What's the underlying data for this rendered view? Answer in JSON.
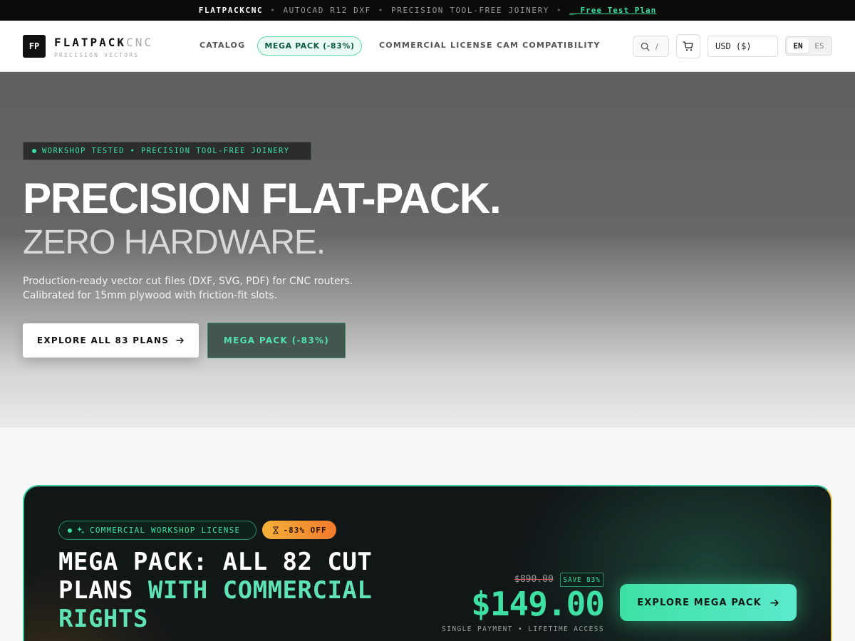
{
  "topbar": {
    "brand": "FLATPACKCNC",
    "sep1": "•",
    "format": "AUTOCAD R12 DXF",
    "sep2": "•",
    "tagline": "PRECISION TOOL-FREE JOINERY",
    "sep3": "•",
    "link": "_ Free Test Plan"
  },
  "header": {
    "logo_mark": "FP",
    "logo_name_main": "FLATPACK",
    "logo_name_suffix": "CNC",
    "logo_sub": "PRECISION VECTORS",
    "nav": {
      "catalog": "CATALOG",
      "mega_pack": "MEGA PACK (-83%)",
      "commercial": "COMMERCIAL LICENSE",
      "cam": "CAM COMPATIBILITY"
    },
    "search_shortcut": "/",
    "currency": "USD ($)",
    "lang_en": "EN",
    "lang_es": "ES"
  },
  "hero": {
    "badge": "WORKSHOP TESTED • PRECISION TOOL-FREE JOINERY",
    "title": "PRECISION FLAT-PACK.",
    "subtitle": "ZERO HARDWARE.",
    "description": "Production-ready vector cut files (DXF, SVG, PDF) for CNC routers. Calibrated for 15mm plywood with friction-fit slots.",
    "cta_primary": "EXPLORE ALL 83 PLANS",
    "cta_secondary": "MEGA PACK (-83%)"
  },
  "mega_card": {
    "badge": "COMMERCIAL WORKSHOP LICENSE",
    "off_badge": "-83% OFF",
    "title_main": "MEGA PACK: ALL 82 CUT PLANS ",
    "title_accent": "WITH COMMERCIAL RIGHTS",
    "price_old": "$890.00",
    "save_badge": "SAVE 83%",
    "price": "$149.00",
    "price_note": "SINGLE PAYMENT • LIFETIME ACCESS",
    "cta": "EXPLORE MEGA PACK"
  },
  "colors": {
    "accent": "#3ee0a4",
    "dark": "#0b0b0b",
    "card_bg": "#111617",
    "orange": "#f37a2b"
  }
}
